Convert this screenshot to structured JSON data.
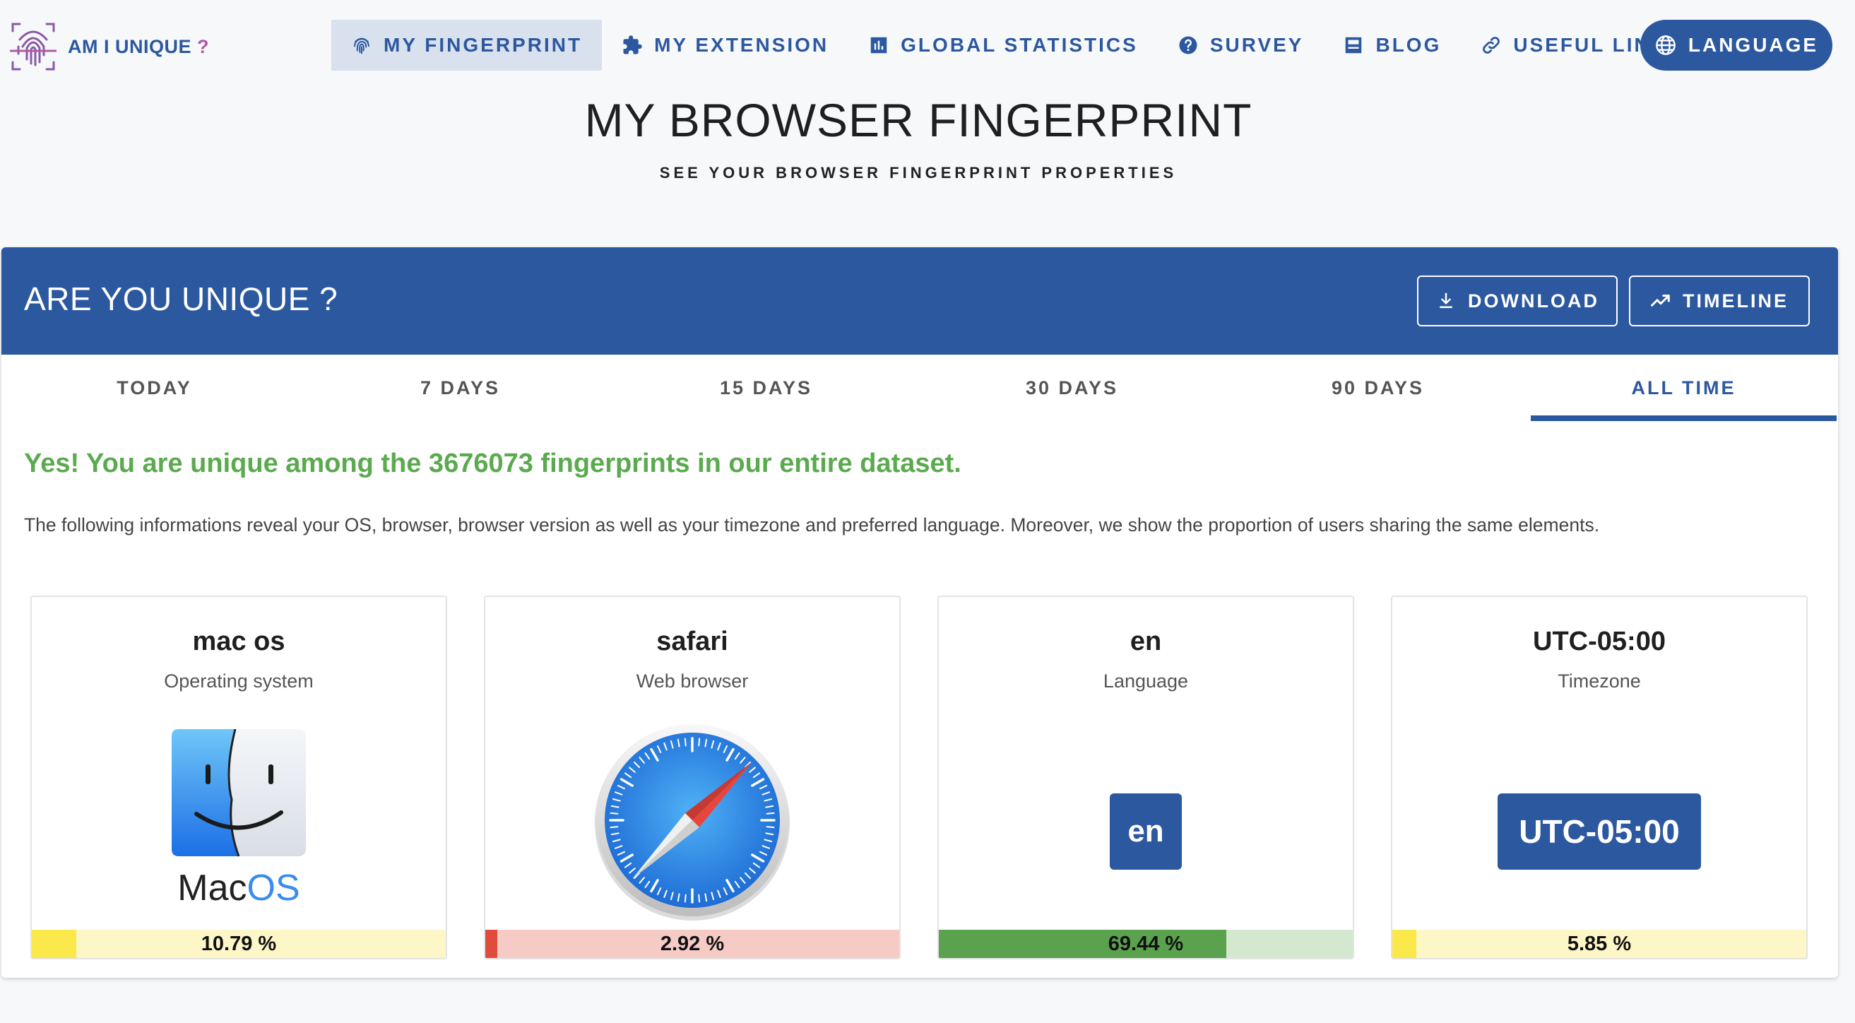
{
  "logo": {
    "text": "AM I UNIQUE",
    "suffix": "?"
  },
  "nav": {
    "items": [
      {
        "label": "MY FINGERPRINT"
      },
      {
        "label": "MY EXTENSION"
      },
      {
        "label": "GLOBAL STATISTICS"
      },
      {
        "label": "SURVEY"
      },
      {
        "label": "BLOG"
      },
      {
        "label": "USEFUL LINKS"
      }
    ],
    "language_label": "LANGUAGE"
  },
  "page": {
    "title": "MY BROWSER FINGERPRINT",
    "subtitle": "SEE YOUR BROWSER FINGERPRINT PROPERTIES"
  },
  "card": {
    "title": "ARE YOU UNIQUE ?",
    "download_label": "DOWNLOAD",
    "timeline_label": "TIMELINE",
    "tabs": [
      "TODAY",
      "7 DAYS",
      "15 DAYS",
      "30 DAYS",
      "90 DAYS",
      "ALL TIME"
    ],
    "active_tab": "ALL TIME",
    "unique_message": "Yes! You are unique among the 3676073 fingerprints in our entire dataset.",
    "description": "The following informations reveal your OS, browser, browser version as well as your timezone and preferred language. Moreover, we show the proportion of users sharing the same elements."
  },
  "colors": {
    "primary": "#2c58a0",
    "unique_green": "#5aaa4e"
  },
  "properties": [
    {
      "value": "mac os",
      "label": "Operating system",
      "icon": "macos-finder-icon",
      "logo_text_a": "Mac",
      "logo_text_b": "OS",
      "percent_text": "10.79 %",
      "percent": 10.79,
      "fill_color": "#fbe84b",
      "track_color": "#fdf6c7"
    },
    {
      "value": "safari",
      "label": "Web browser",
      "icon": "safari-compass-icon",
      "percent_text": "2.92 %",
      "percent": 2.92,
      "fill_color": "#e04b3c",
      "track_color": "#f6cbc6"
    },
    {
      "value": "en",
      "label": "Language",
      "badge": "en",
      "percent_text": "69.44 %",
      "percent": 69.44,
      "fill_color": "#5aa24e",
      "track_color": "#d4e8cf"
    },
    {
      "value": "UTC-05:00",
      "label": "Timezone",
      "badge": "UTC-05:00",
      "percent_text": "5.85 %",
      "percent": 5.85,
      "fill_color": "#fbe84b",
      "track_color": "#fdf6c7"
    }
  ]
}
